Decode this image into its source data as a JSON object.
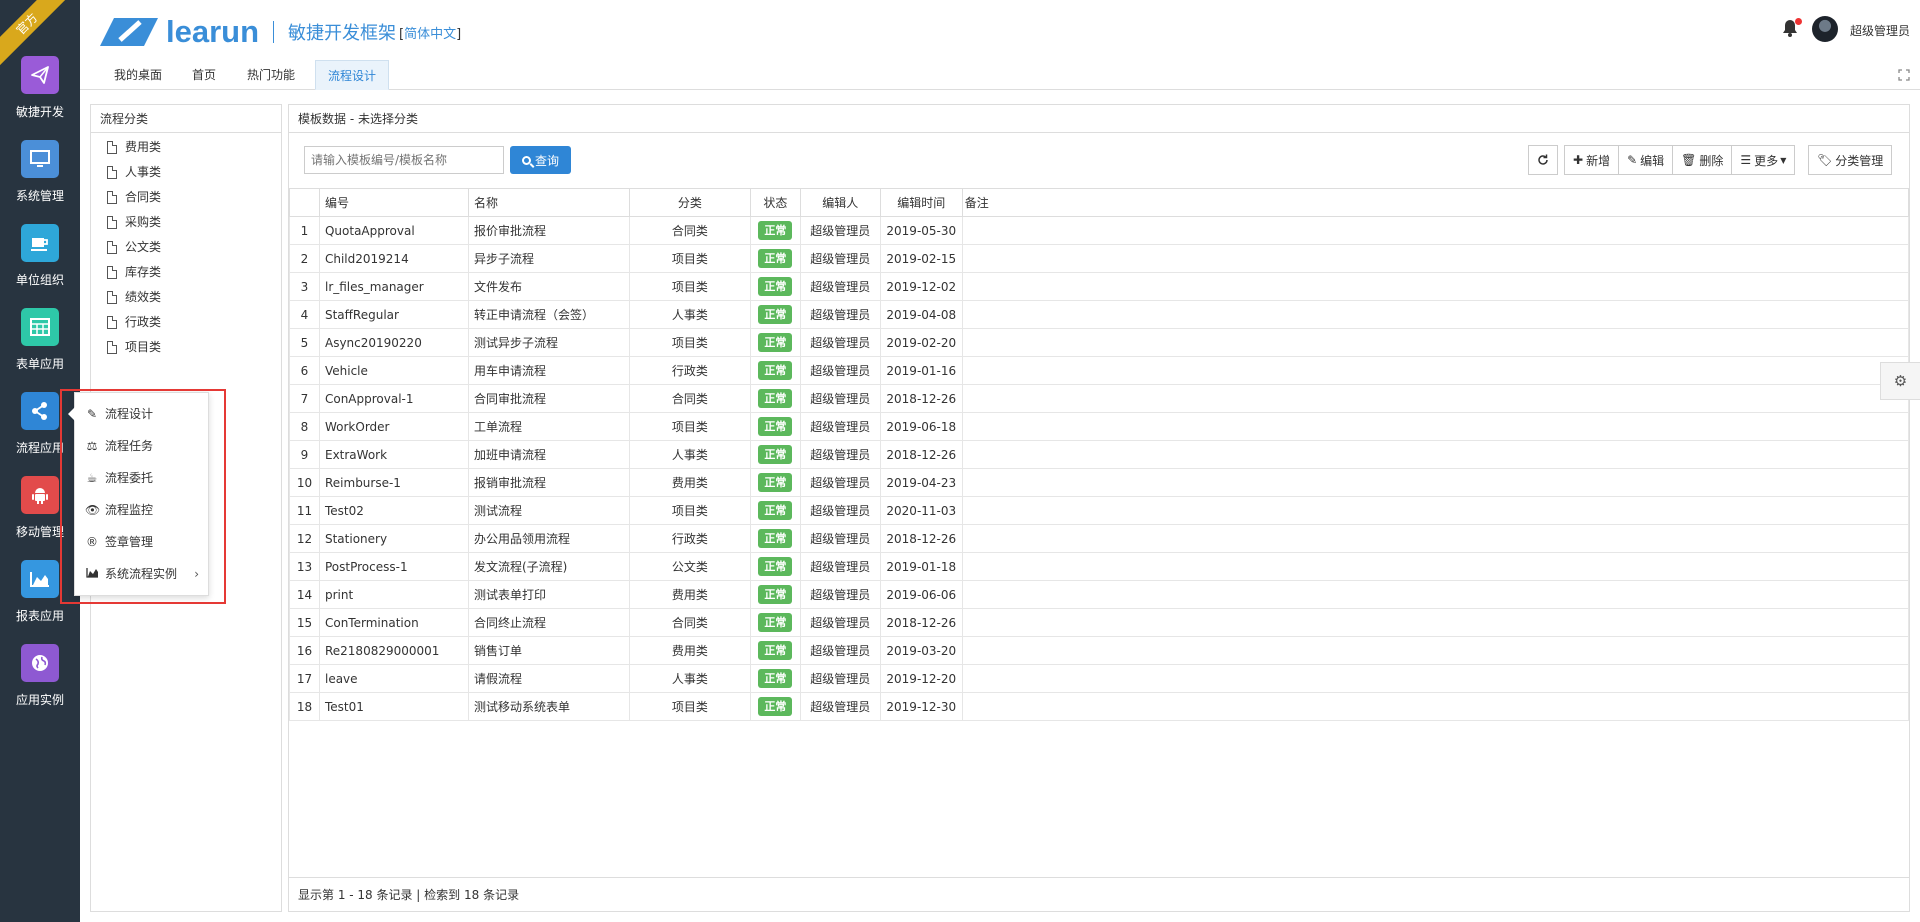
{
  "ribbon": "官方",
  "nav": [
    {
      "label": "敏捷开发",
      "icon": "paper-plane-icon",
      "color": "#9a5bd8"
    },
    {
      "label": "系统管理",
      "icon": "monitor-icon",
      "color": "#4b8fd8"
    },
    {
      "label": "单位组织",
      "icon": "coffee-icon",
      "color": "#2ea7d9"
    },
    {
      "label": "表单应用",
      "icon": "table-icon",
      "color": "#2ec8a8"
    },
    {
      "label": "流程应用",
      "icon": "share-icon",
      "color": "#2f86d6"
    },
    {
      "label": "移动管理",
      "icon": "android-icon",
      "color": "#e24b4b"
    },
    {
      "label": "报表应用",
      "icon": "area-chart-icon",
      "color": "#3597e0"
    },
    {
      "label": "应用实例",
      "icon": "globe-icon",
      "color": "#8e59d2"
    }
  ],
  "header": {
    "logo_text": "learun",
    "title": "敏捷开发框架",
    "lang_bracket_open": "[",
    "lang": "简体中文",
    "lang_bracket_close": "]",
    "username": "超级管理员"
  },
  "tabs": [
    "我的桌面",
    "首页",
    "热门功能",
    "流程设计"
  ],
  "category_panel": {
    "title": "流程分类",
    "items": [
      "费用类",
      "人事类",
      "合同类",
      "采购类",
      "公文类",
      "库存类",
      "绩效类",
      "行政类",
      "项目类"
    ]
  },
  "main_panel": {
    "title": "模板数据 - 未选择分类",
    "search_placeholder": "请输入模板编号/模板名称",
    "query_label": "查询",
    "buttons": {
      "add": "新增",
      "edit": "编辑",
      "delete": "删除",
      "more": "更多",
      "category_manage": "分类管理"
    },
    "columns": [
      "编号",
      "名称",
      "分类",
      "状态",
      "编辑人",
      "编辑时间",
      "备注"
    ],
    "rows": [
      {
        "n": "1",
        "code": "QuotaApproval",
        "name": "报价审批流程",
        "category": "合同类",
        "status": "正常",
        "editor": "超级管理员",
        "time": "2019-05-30",
        "remark": ""
      },
      {
        "n": "2",
        "code": "Child2019214",
        "name": "异步子流程",
        "category": "项目类",
        "status": "正常",
        "editor": "超级管理员",
        "time": "2019-02-15",
        "remark": ""
      },
      {
        "n": "3",
        "code": "lr_files_manager",
        "name": "文件发布",
        "category": "项目类",
        "status": "正常",
        "editor": "超级管理员",
        "time": "2019-12-02",
        "remark": ""
      },
      {
        "n": "4",
        "code": "StaffRegular",
        "name": "转正申请流程（会签）",
        "category": "人事类",
        "status": "正常",
        "editor": "超级管理员",
        "time": "2019-04-08",
        "remark": ""
      },
      {
        "n": "5",
        "code": "Async20190220",
        "name": "测试异步子流程",
        "category": "项目类",
        "status": "正常",
        "editor": "超级管理员",
        "time": "2019-02-20",
        "remark": ""
      },
      {
        "n": "6",
        "code": "Vehicle",
        "name": "用车申请流程",
        "category": "行政类",
        "status": "正常",
        "editor": "超级管理员",
        "time": "2019-01-16",
        "remark": ""
      },
      {
        "n": "7",
        "code": "ConApproval-1",
        "name": "合同审批流程",
        "category": "合同类",
        "status": "正常",
        "editor": "超级管理员",
        "time": "2018-12-26",
        "remark": ""
      },
      {
        "n": "8",
        "code": "WorkOrder",
        "name": "工单流程",
        "category": "项目类",
        "status": "正常",
        "editor": "超级管理员",
        "time": "2019-06-18",
        "remark": ""
      },
      {
        "n": "9",
        "code": "ExtraWork",
        "name": "加班申请流程",
        "category": "人事类",
        "status": "正常",
        "editor": "超级管理员",
        "time": "2018-12-26",
        "remark": ""
      },
      {
        "n": "10",
        "code": "Reimburse-1",
        "name": "报销审批流程",
        "category": "费用类",
        "status": "正常",
        "editor": "超级管理员",
        "time": "2019-04-23",
        "remark": ""
      },
      {
        "n": "11",
        "code": "Test02",
        "name": "测试流程",
        "category": "项目类",
        "status": "正常",
        "editor": "超级管理员",
        "time": "2020-11-03",
        "remark": ""
      },
      {
        "n": "12",
        "code": "Stationery",
        "name": "办公用品领用流程",
        "category": "行政类",
        "status": "正常",
        "editor": "超级管理员",
        "time": "2018-12-26",
        "remark": ""
      },
      {
        "n": "13",
        "code": "PostProcess-1",
        "name": "发文流程(子流程)",
        "category": "公文类",
        "status": "正常",
        "editor": "超级管理员",
        "time": "2019-01-18",
        "remark": ""
      },
      {
        "n": "14",
        "code": "print",
        "name": "测试表单打印",
        "category": "费用类",
        "status": "正常",
        "editor": "超级管理员",
        "time": "2019-06-06",
        "remark": ""
      },
      {
        "n": "15",
        "code": "ConTermination",
        "name": "合同终止流程",
        "category": "合同类",
        "status": "正常",
        "editor": "超级管理员",
        "time": "2018-12-26",
        "remark": ""
      },
      {
        "n": "16",
        "code": "Re2180829000001",
        "name": "销售订单",
        "category": "费用类",
        "status": "正常",
        "editor": "超级管理员",
        "time": "2019-03-20",
        "remark": ""
      },
      {
        "n": "17",
        "code": "leave",
        "name": "请假流程",
        "category": "人事类",
        "status": "正常",
        "editor": "超级管理员",
        "time": "2019-12-20",
        "remark": ""
      },
      {
        "n": "18",
        "code": "Test01",
        "name": "测试移动系统表单",
        "category": "项目类",
        "status": "正常",
        "editor": "超级管理员",
        "time": "2019-12-30",
        "remark": ""
      }
    ],
    "footer": "显示第 1 - 18 条记录 | 检索到 18 条记录"
  },
  "submenu": [
    {
      "label": "流程设计",
      "icon": "edit-icon"
    },
    {
      "label": "流程任务",
      "icon": "scale-icon"
    },
    {
      "label": "流程委托",
      "icon": "coffee-cup-icon"
    },
    {
      "label": "流程监控",
      "icon": "eye-icon"
    },
    {
      "label": "签章管理",
      "icon": "registered-icon"
    },
    {
      "label": "系统流程实例",
      "icon": "area-chart-icon"
    }
  ],
  "colors": {
    "accent": "#2f86d6",
    "status_ok": "#5cb85c",
    "nav_bg": "#283440",
    "highlight_box": "#e53935"
  }
}
